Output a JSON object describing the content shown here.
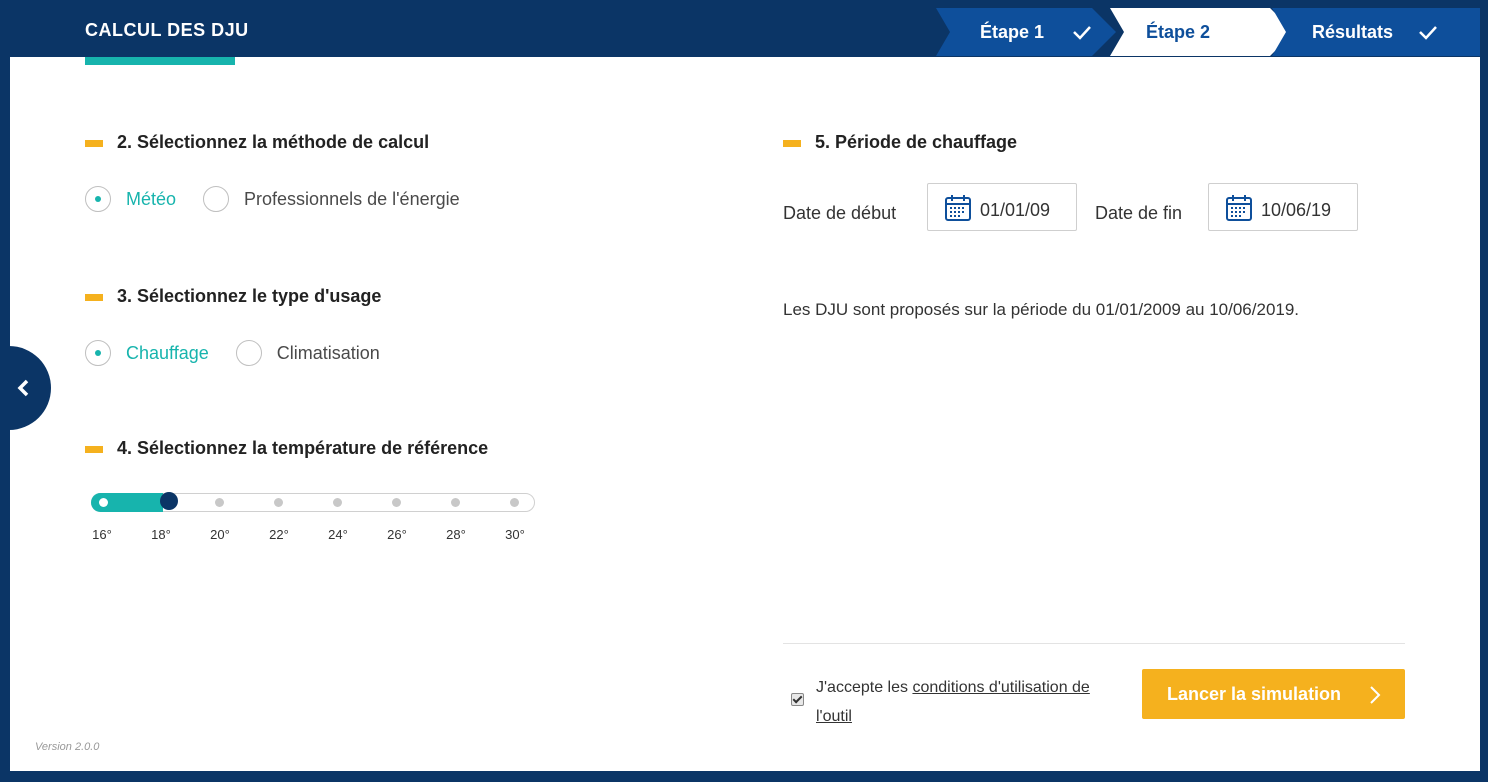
{
  "app": {
    "title": "CALCUL DES DJU",
    "version": "Version 2.0.0"
  },
  "stepper": [
    {
      "label": "Étape 1",
      "done": true,
      "state": "completed"
    },
    {
      "label": "Étape 2",
      "done": false,
      "state": "current"
    },
    {
      "label": "Résultats",
      "done": true,
      "state": "completed"
    }
  ],
  "method": {
    "title": "2. Sélectionnez la méthode de calcul",
    "options": [
      "Météo",
      "Professionnels de l'énergie"
    ],
    "selected": "Météo"
  },
  "usage": {
    "title": "3. Sélectionnez le type d'usage",
    "options": [
      "Chauffage",
      "Climatisation"
    ],
    "selected": "Chauffage"
  },
  "temperature": {
    "title": "4. Sélectionnez la température de référence",
    "ticks": [
      "16°",
      "18°",
      "20°",
      "22°",
      "24°",
      "26°",
      "28°",
      "30°"
    ],
    "selected": "18°"
  },
  "period": {
    "title": "5. Période de chauffage",
    "start_label": "Date de début",
    "start_value": "01/01/09",
    "end_label": "Date de fin",
    "end_value": "10/06/19",
    "info": "Les DJU sont proposés sur la période du 01/01/2009 au 10/06/2019."
  },
  "terms": {
    "prefix": "J'accepte les ",
    "link": "conditions d'utilisation de l'outil",
    "checked": true
  },
  "cta": {
    "label": "Lancer la simulation"
  },
  "colors": {
    "navy": "#0b3566",
    "teal": "#17b4ad",
    "yellow": "#f5b11e",
    "blue": "#0e4f9b"
  }
}
